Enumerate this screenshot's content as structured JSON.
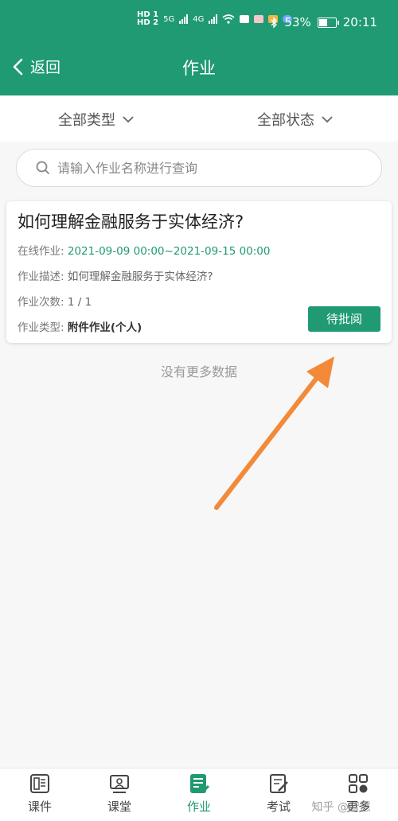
{
  "status_bar": {
    "hd1": "HD 1",
    "hd2": "HD 2",
    "net1": "5G",
    "net2": "4G",
    "battery": "53%",
    "time": "20:11",
    "battery_level": 0.53
  },
  "nav": {
    "back_label": "返回",
    "title": "作业"
  },
  "filters": {
    "type": "全部类型",
    "status": "全部状态"
  },
  "search": {
    "placeholder": "请输入作业名称进行查询"
  },
  "assignment": {
    "title": "如何理解金融服务于实体经济?",
    "online_label": "在线作业:",
    "online_value": "2021-09-09 00:00~2021-09-15 00:00",
    "desc_label": "作业描述:",
    "desc_value": "如何理解金融服务于实体经济?",
    "count_label": "作业次数:",
    "count_value": "1 / 1",
    "kind_label": "作业类型:",
    "kind_value": "附件作业(个人)",
    "status": "待批阅"
  },
  "list_end": "没有更多数据",
  "tabs": [
    {
      "label": "课件",
      "icon": "courseware-icon"
    },
    {
      "label": "课堂",
      "icon": "classroom-icon"
    },
    {
      "label": "作业",
      "icon": "homework-icon"
    },
    {
      "label": "考试",
      "icon": "exam-icon"
    },
    {
      "label": "更多",
      "icon": "more-icon"
    }
  ],
  "watermark": "知乎 @智慧",
  "colors": {
    "primary": "#1f9a73",
    "arrow": "#f28a3a"
  }
}
